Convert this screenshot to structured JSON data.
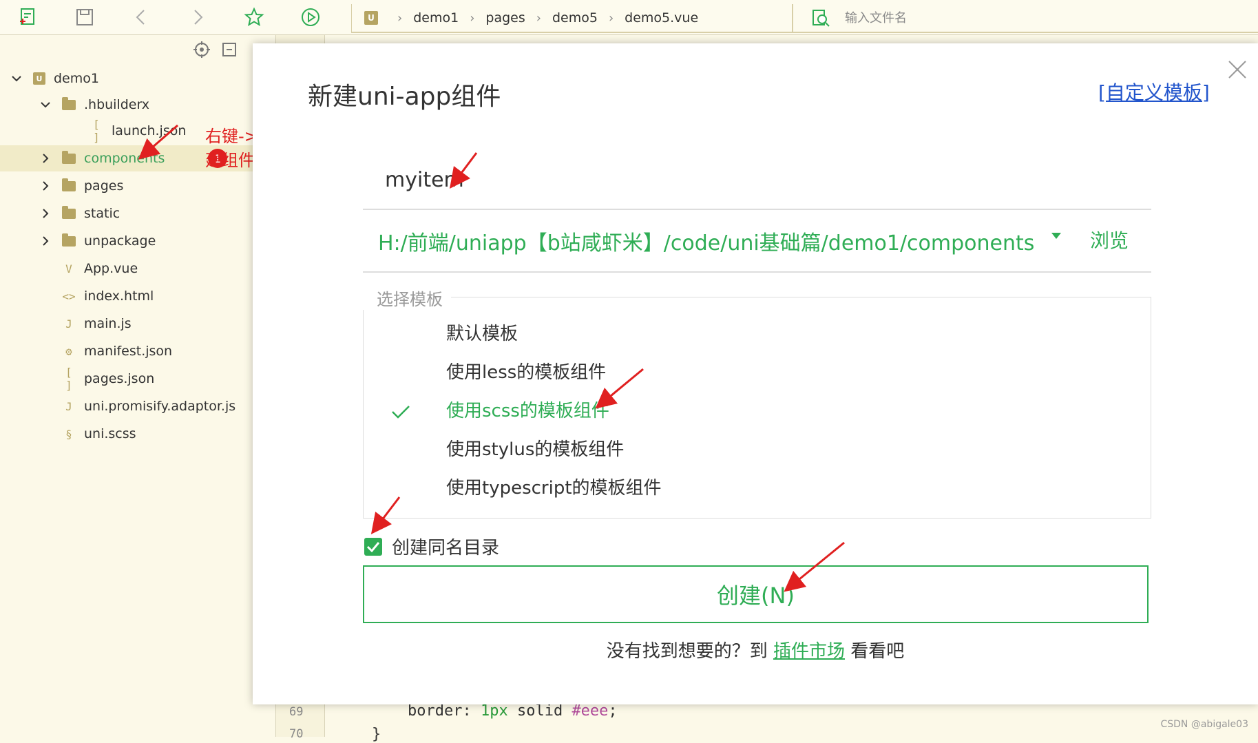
{
  "toolbar": {
    "icons": [
      "new-file-icon",
      "save-icon",
      "back-icon",
      "forward-icon",
      "star-icon",
      "run-icon"
    ],
    "breadcrumb": [
      "demo1",
      "pages",
      "demo5",
      "demo5.vue"
    ],
    "file_search_placeholder": "输入文件名"
  },
  "sidebar": {
    "tree": [
      {
        "label": "demo1",
        "kind": "project",
        "expanded": true,
        "depth": 0
      },
      {
        "label": ".hbuilderx",
        "kind": "folder",
        "expanded": true,
        "depth": 1
      },
      {
        "label": "launch.json",
        "kind": "json",
        "depth": 2
      },
      {
        "label": "components",
        "kind": "folder",
        "expanded": false,
        "depth": 1,
        "selected": true
      },
      {
        "label": "pages",
        "kind": "folder",
        "expanded": false,
        "depth": 1
      },
      {
        "label": "static",
        "kind": "folder",
        "expanded": false,
        "depth": 1
      },
      {
        "label": "unpackage",
        "kind": "folder",
        "expanded": false,
        "depth": 1
      },
      {
        "label": "App.vue",
        "kind": "vue",
        "depth": 1
      },
      {
        "label": "index.html",
        "kind": "html",
        "depth": 1
      },
      {
        "label": "main.js",
        "kind": "js",
        "depth": 1
      },
      {
        "label": "manifest.json",
        "kind": "manifest",
        "depth": 1
      },
      {
        "label": "pages.json",
        "kind": "json",
        "depth": 1
      },
      {
        "label": "uni.promisify.adaptor.js",
        "kind": "js",
        "depth": 1
      },
      {
        "label": "uni.scss",
        "kind": "scss",
        "depth": 1
      }
    ],
    "step_badge": "1",
    "annotation": "右键->新建组件"
  },
  "editor": {
    "line_numbers": [
      "69",
      "70"
    ],
    "code_prop": "border: ",
    "code_num": "1px",
    "code_mid": " solid ",
    "code_hex": "#eee",
    "code_end": ";",
    "code_brace": "}"
  },
  "dialog": {
    "title": "新建uni-app组件",
    "custom_template_link": "[自定义模板]",
    "component_name": "myitem",
    "path": "H:/前端/uniapp【b站咸虾米】/code/uni基础篇/demo1/components",
    "browse_label": "浏览",
    "template_legend": "选择模板",
    "templates": [
      "默认模板",
      "使用less的模板组件",
      "使用scss的模板组件",
      "使用stylus的模板组件",
      "使用typescript的模板组件"
    ],
    "selected_template": "使用scss的模板组件",
    "create_dir_label": "创建同名目录",
    "create_dir_checked": true,
    "create_button": "创建(N)",
    "footer_before": "没有找到想要的？到 ",
    "footer_link": "插件市场",
    "footer_after": " 看看吧"
  },
  "watermark": "CSDN @abigale03",
  "colors": {
    "accent": "#2fad55",
    "annotation": "#e02020",
    "sidebar_bg": "#fcf9e8",
    "link": "#2255cc"
  }
}
